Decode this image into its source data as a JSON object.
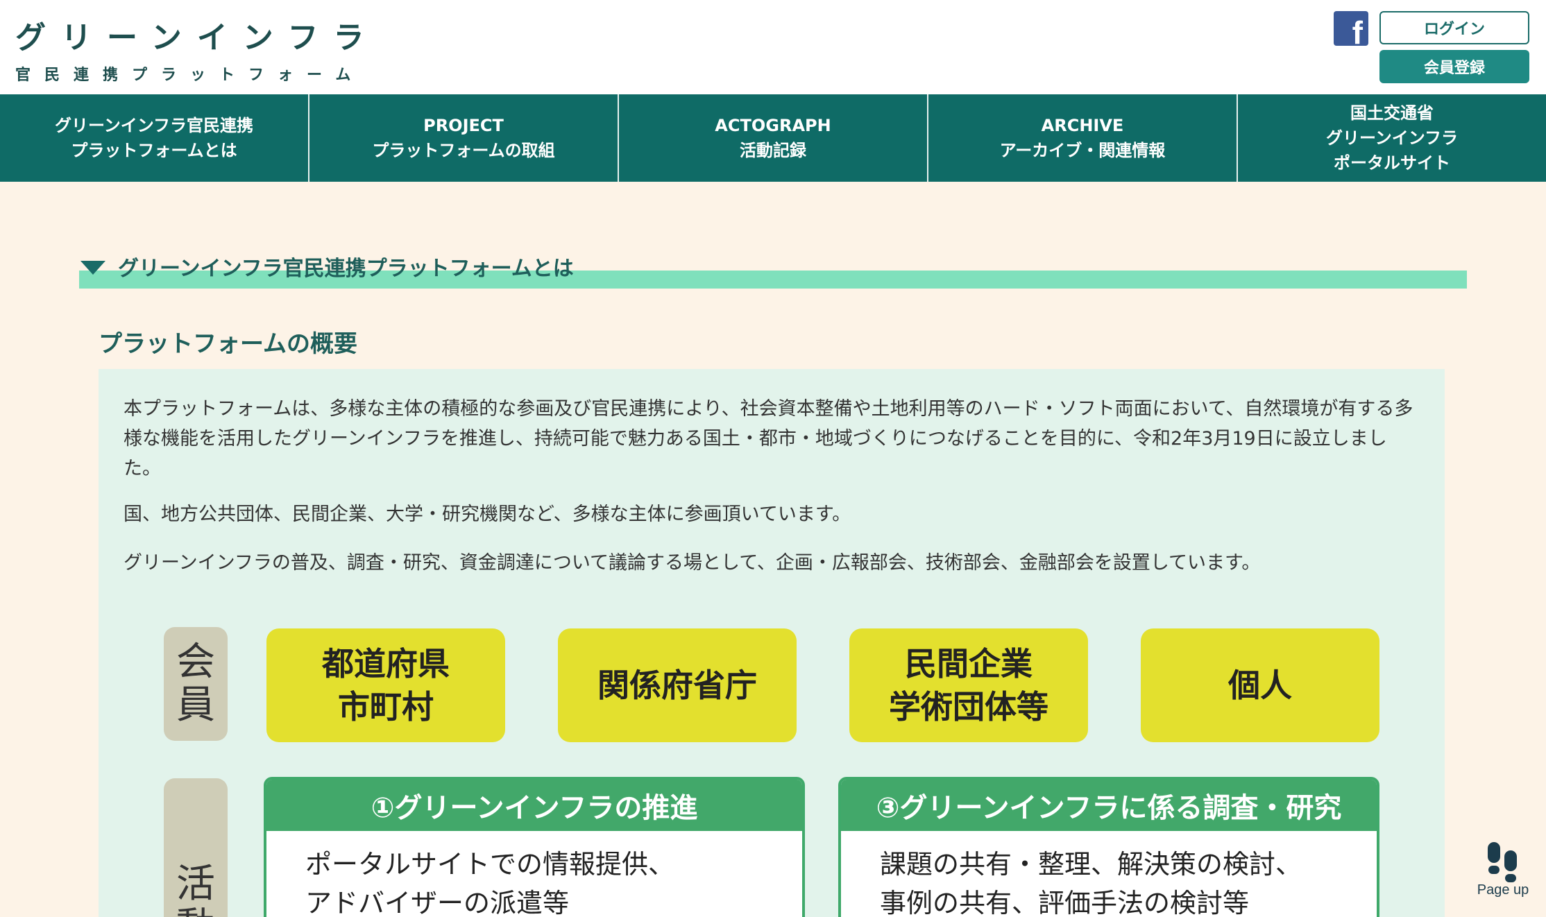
{
  "header": {
    "logo_title": "グリーンインフラ",
    "logo_subtitle": "官民連携プラットフォーム",
    "facebook_icon": "facebook-icon",
    "login_label": "ログイン",
    "register_label": "会員登録"
  },
  "nav": {
    "items": [
      {
        "line1": "グリーンインフラ官民連携",
        "line2": "プラットフォームとは"
      },
      {
        "line1": "PROJECT",
        "line2": "プラットフォームの取組"
      },
      {
        "line1": "ACTOGRAPH",
        "line2": "活動記録"
      },
      {
        "line1": "ARCHIVE",
        "line2": "アーカイブ・関連情報"
      },
      {
        "line1": "国土交通省",
        "line2": "グリーンインフラ",
        "line3": "ポータルサイト"
      }
    ]
  },
  "section": {
    "title": "グリーンインフラ官民連携プラットフォームとは",
    "overview_title": "プラットフォームの概要",
    "paragraphs": [
      "本プラットフォームは、多様な主体の積極的な参画及び官民連携により、社会資本整備や土地利用等のハード・ソフト両面において、自然環境が有する多様な機能を活用したグリーンインフラを推進し、持続可能で魅力ある国土・都市・地域づくりにつなげることを目的に、令和2年3月19日に設立しました。",
      "国、地方公共団体、民間企業、大学・研究機関など、多様な主体に参画頂いています。",
      "グリーンインフラの普及、調査・研究、資金調達について議論する場として、企画・広報部会、技術部会、金融部会を設置しています。"
    ]
  },
  "diagram": {
    "member_label": [
      "会",
      "員"
    ],
    "activity_label": [
      "活",
      "動"
    ],
    "members": [
      {
        "line1": "都道府県",
        "line2": "市町村"
      },
      {
        "line1": "関係府省庁",
        "line2": ""
      },
      {
        "line1": "民間企業",
        "line2": "学術団体等"
      },
      {
        "line1": "個人",
        "line2": ""
      }
    ],
    "activities": [
      {
        "title": "①グリーンインフラの推進",
        "line1": "ポータルサイトでの情報提供、",
        "line2": "アドバイザーの派遣等"
      },
      {
        "title": "③グリーンインフラに係る調査・研究",
        "line1": "課題の共有・整理、解決策の検討、",
        "line2": "事例の共有、評価手法の検討等"
      }
    ]
  },
  "page_up": {
    "label": "Page up",
    "icon": "footprints-icon"
  }
}
